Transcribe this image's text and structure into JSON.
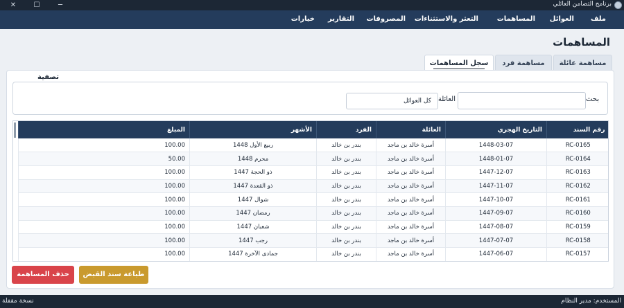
{
  "window": {
    "title": "برنامج التضامن العائلي",
    "minimize": "─",
    "maximize": "☐",
    "close": "✕"
  },
  "menu": [
    "ملف",
    "العوائل",
    "المساهمات",
    "التعثر والاستثناءات",
    "المصروفات",
    "التقارير",
    "خيارات"
  ],
  "page_title": "المساهمات",
  "tabs": [
    "مساهمة عائلة",
    "مساهمة فرد",
    "سجل المساهمات"
  ],
  "active_tab": "سجل المساهمات",
  "filter": {
    "legend": "تصفية",
    "search_label": "بحث",
    "search_value": "",
    "family_label": "العائلة",
    "family_value": "كل العوائل"
  },
  "table": {
    "columns": [
      "رقم السند",
      "التاريخ الهجري",
      "العائلة",
      "الفرد",
      "الأشهر",
      "المبلغ"
    ],
    "rows": [
      [
        "RC-0165",
        "1448-03-07",
        "أسرة خالد بن ماجد",
        "بندر بن خالد",
        "ربيع الأول 1448",
        "100.00"
      ],
      [
        "RC-0164",
        "1448-01-07",
        "أسرة خالد بن ماجد",
        "بندر بن خالد",
        "محرم 1448",
        "50.00"
      ],
      [
        "RC-0163",
        "1447-12-07",
        "أسرة خالد بن ماجد",
        "بندر بن خالد",
        "ذو الحجة 1447",
        "100.00"
      ],
      [
        "RC-0162",
        "1447-11-07",
        "أسرة خالد بن ماجد",
        "بندر بن خالد",
        "ذو القعدة 1447",
        "100.00"
      ],
      [
        "RC-0161",
        "1447-10-07",
        "أسرة خالد بن ماجد",
        "بندر بن خالد",
        "شوال 1447",
        "100.00"
      ],
      [
        "RC-0160",
        "1447-09-07",
        "أسرة خالد بن ماجد",
        "بندر بن خالد",
        "رمضان 1447",
        "100.00"
      ],
      [
        "RC-0159",
        "1447-08-07",
        "أسرة خالد بن ماجد",
        "بندر بن خالد",
        "شعبان 1447",
        "100.00"
      ],
      [
        "RC-0158",
        "1447-07-07",
        "أسرة خالد بن ماجد",
        "بندر بن خالد",
        "رجب 1447",
        "100.00"
      ],
      [
        "RC-0157",
        "1447-06-07",
        "أسرة خالد بن ماجد",
        "بندر بن خالد",
        "جمادى الآخرة 1447",
        "100.00"
      ]
    ]
  },
  "buttons": {
    "print_receipt": "طباعة سند القبض",
    "delete_contribution": "حذف المساهمة"
  },
  "status": {
    "user": "المستخدم: مدير النظام",
    "version": "نسخة مقفلة"
  },
  "colors": {
    "menubar": "#243c5c",
    "header": "#243c5c",
    "print_button": "#c99a2e",
    "delete_button": "#d9444a"
  }
}
